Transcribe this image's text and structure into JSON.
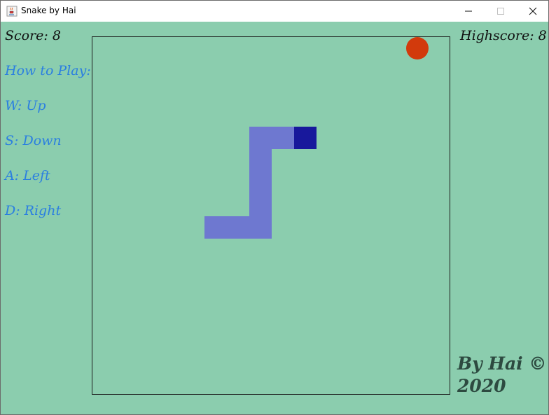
{
  "window": {
    "title": "Snake by Hai",
    "icon": "java-cup-icon",
    "controls": [
      "minimize-icon",
      "maximize-icon",
      "close-icon"
    ]
  },
  "hud": {
    "score": "Score: 8",
    "highscore": "Highscore: 8"
  },
  "instructions": {
    "heading": "How to Play:",
    "up": "W: Up",
    "down": "S: Down",
    "left": "A: Left",
    "right": "D: Right"
  },
  "credit": {
    "line1": "By Hai ©",
    "line2": "2020"
  },
  "game": {
    "colors": {
      "background": "#8bcdae",
      "snake_body": "#6e78d0",
      "snake_head": "#18189c",
      "apple": "#d23a0c",
      "instruction_text": "#2b7fe0"
    }
  }
}
